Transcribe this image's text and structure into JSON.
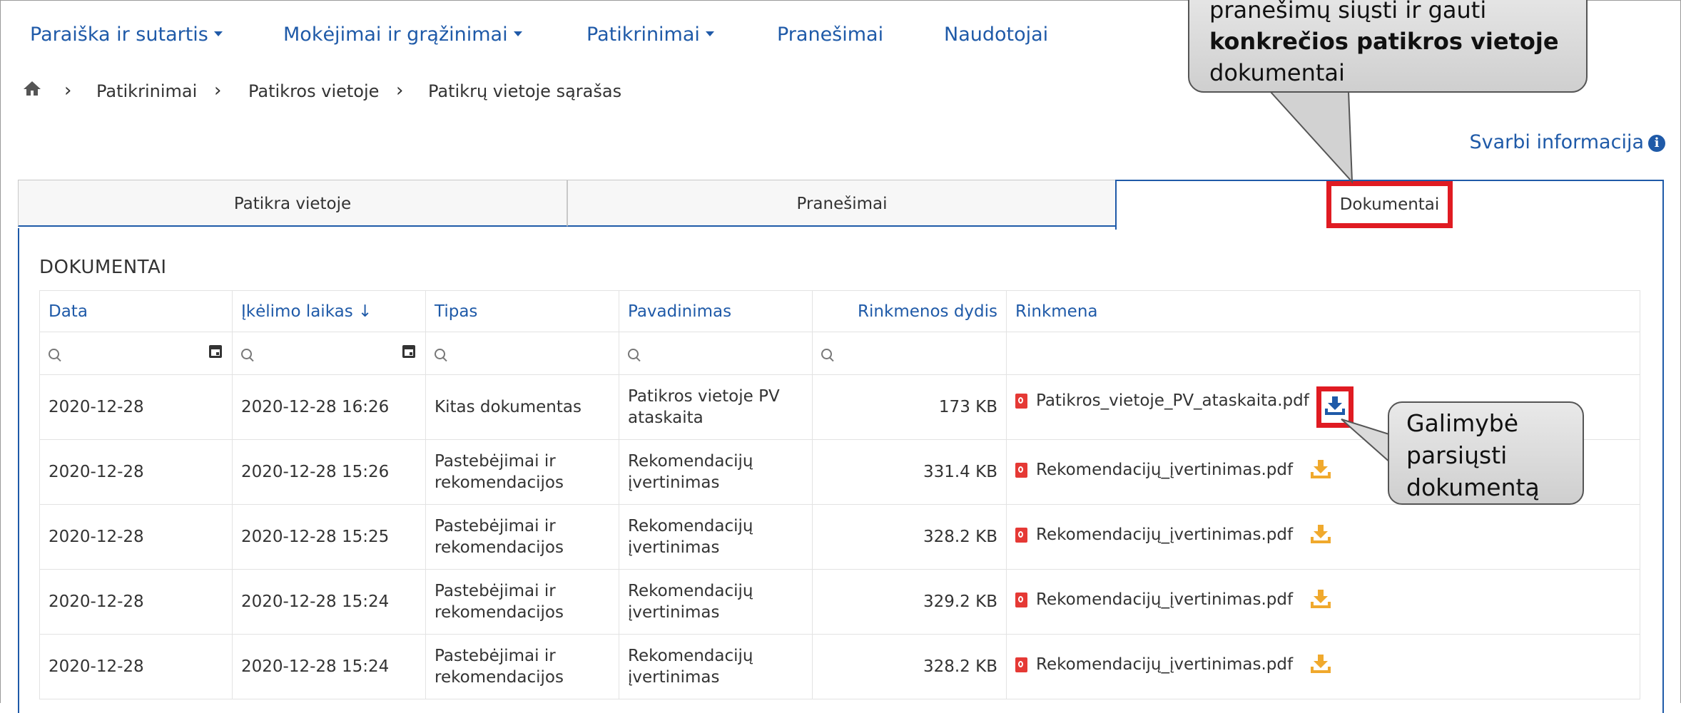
{
  "nav": {
    "items": [
      {
        "label": "Paraiška ir sutartis",
        "caret": true
      },
      {
        "label": "Mokėjimai ir grąžinimai",
        "caret": true
      },
      {
        "label": "Patikrinimai",
        "caret": true
      },
      {
        "label": "Pranešimai",
        "caret": false
      },
      {
        "label": "Naudotojai",
        "caret": false
      }
    ]
  },
  "breadcrumb": {
    "home_icon": "home-icon",
    "items": [
      "Patikrinimai",
      "Patikros vietoje",
      "Patikrų vietoje sąrašas"
    ]
  },
  "important_info": {
    "label": "Svarbi informacija",
    "icon": "info-icon"
  },
  "tabs": [
    {
      "label": "Patikra vietoje",
      "active": false
    },
    {
      "label": "Pranešimai",
      "active": false
    },
    {
      "label": "Dokumentai",
      "active": true
    }
  ],
  "section_title": "DOKUMENTAI",
  "table": {
    "columns": [
      "Data",
      "Įkėlimo laikas ↓",
      "Tipas",
      "Pavadinimas",
      "Rinkmenos dydis",
      "Rinkmena"
    ],
    "rows": [
      {
        "data": "2020-12-28",
        "time": "2020-12-28 16:26",
        "type": "Kitas dokumentas",
        "name_line1": "Patikros vietoje PV",
        "name_line2": "ataskaita",
        "size": "173 KB",
        "file": "Patikros_vietoje_PV_ataskaita.pdf",
        "download_color": "#1f5aa8"
      },
      {
        "data": "2020-12-28",
        "time": "2020-12-28 15:26",
        "type_line1": "Pastebėjimai ir",
        "type_line2": "rekomendacijos",
        "name_line1": "Rekomendacijų",
        "name_line2": "įvertinimas",
        "size": "331.4 KB",
        "file": "Rekomendacijų_įvertinimas.pdf",
        "download_color": "#f0a92d"
      },
      {
        "data": "2020-12-28",
        "time": "2020-12-28 15:25",
        "type_line1": "Pastebėjimai ir",
        "type_line2": "rekomendacijos",
        "name_line1": "Rekomendacijų",
        "name_line2": "įvertinimas",
        "size": "328.2 KB",
        "file": "Rekomendacijų_įvertinimas.pdf",
        "download_color": "#f0a92d"
      },
      {
        "data": "2020-12-28",
        "time": "2020-12-28 15:24",
        "type_line1": "Pastebėjimai ir",
        "type_line2": "rekomendacijos",
        "name_line1": "Rekomendacijų",
        "name_line2": "įvertinimas",
        "size": "329.2 KB",
        "file": "Rekomendacijų_įvertinimas.pdf",
        "download_color": "#f0a92d"
      },
      {
        "data": "2020-12-28",
        "time": "2020-12-28 15:24",
        "type_line1": "Pastebėjimai ir",
        "type_line2": "rekomendacijos",
        "name_line1": "Rekomendacijų",
        "name_line2": "įvertinimas",
        "size": "328.2 KB",
        "file": "Rekomendacijų_įvertinimas.pdf",
        "download_color": "#f0a92d"
      }
    ]
  },
  "callouts": {
    "top_line1": "pranešimų siųsti ir gauti",
    "top_bold": "konkrečios patikros vietoje",
    "top_line3": "dokumentai",
    "side_line1": "Galimybė",
    "side_line2": "parsiųsti",
    "side_line3": "dokumentą"
  },
  "colors": {
    "accent": "#1f5aa8",
    "highlight": "#e01b22",
    "download": "#f0a92d"
  }
}
